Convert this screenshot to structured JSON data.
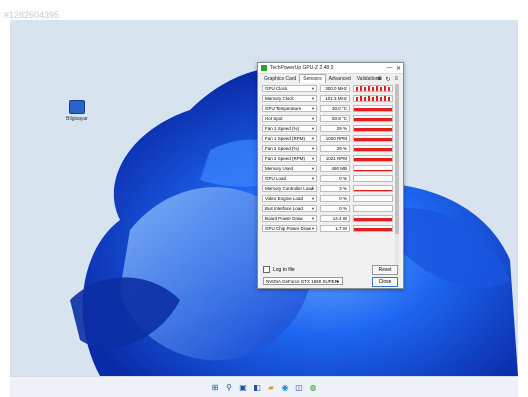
{
  "watermark": "#1282604395",
  "wallpaper": {
    "base_color": "#d7e4ef",
    "bloom_colors": [
      "#0a3fd0",
      "#1d66f0",
      "#6aa8ff",
      "#0a2ba8"
    ]
  },
  "desktop_icon": {
    "label": "Bilgisayar"
  },
  "window": {
    "title": "TechPowerUp GPU-Z 2.48.0",
    "minimize": "—",
    "close": "✕",
    "tabs": [
      {
        "label": "Graphics Card"
      },
      {
        "label": "Sensors"
      },
      {
        "label": "Advanced"
      },
      {
        "label": "Validation"
      }
    ],
    "active_tab": "Sensors",
    "tool_icons": [
      "camera-icon",
      "refresh-icon",
      "menu-icon"
    ],
    "sensors": [
      {
        "name": "GPU Clock",
        "value": "300.0 MHz",
        "graph": "sparse"
      },
      {
        "name": "Memory Clock",
        "value": "101.3 MHz",
        "graph": "sparse"
      },
      {
        "name": "GPU Temperature",
        "value": "30.0 °C",
        "graph": "full"
      },
      {
        "name": "Hot Spot",
        "value": "50.8 °C",
        "graph": "full"
      },
      {
        "name": "Fan 1 Speed (%)",
        "value": "29 %",
        "graph": "full"
      },
      {
        "name": "Fan 1 Speed (RPM)",
        "value": "1020 RPM",
        "graph": "full"
      },
      {
        "name": "Fan 2 Speed (%)",
        "value": "29 %",
        "graph": "full"
      },
      {
        "name": "Fan 2 Speed (RPM)",
        "value": "1021 RPM",
        "graph": "full"
      },
      {
        "name": "Memory Used",
        "value": "450 MB",
        "graph": "low"
      },
      {
        "name": "GPU Load",
        "value": "0 %",
        "graph": "none"
      },
      {
        "name": "Memory Controller Load",
        "value": "3 %",
        "graph": "low"
      },
      {
        "name": "Video Engine Load",
        "value": "0 %",
        "graph": "none"
      },
      {
        "name": "Bus Interface Load",
        "value": "0 %",
        "graph": "none"
      },
      {
        "name": "Board Power Draw",
        "value": "14.4 W",
        "graph": "full"
      },
      {
        "name": "GPU Chip Power Draw",
        "value": "1.7 W",
        "graph": "full"
      }
    ],
    "log_to_file": "Log to file",
    "reset": "Reset",
    "gpu_select": "NVIDIA GeForce GTX 1660 SUPER",
    "close_button": "Close",
    "graph_color": "#e21d1d"
  },
  "taskbar": {
    "icons": [
      "windows-start-icon",
      "search-icon",
      "task-view-icon",
      "chat-icon",
      "file-explorer-icon",
      "edge-icon",
      "store-icon",
      "app-icon"
    ]
  }
}
